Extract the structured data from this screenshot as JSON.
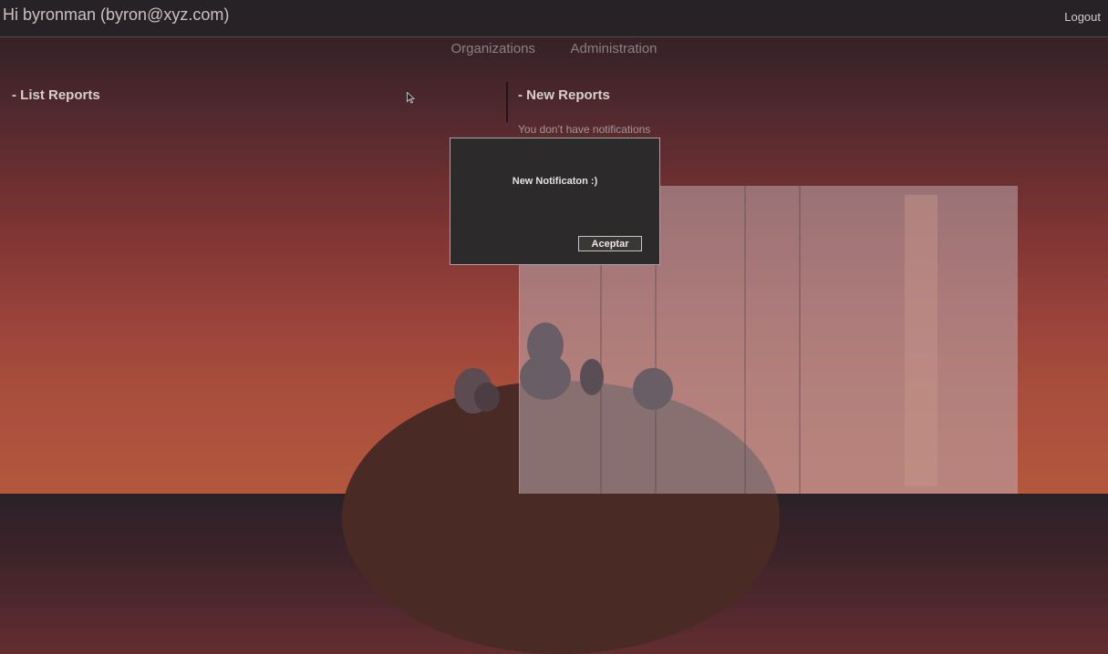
{
  "header": {
    "greeting": "Hi byronman (byron@xyz.com)",
    "logout_label": "Logout"
  },
  "nav": {
    "items": [
      {
        "label": "Organizations"
      },
      {
        "label": "Administration"
      }
    ]
  },
  "main": {
    "list_reports_heading": "- List Reports",
    "new_reports_heading": "- New Reports",
    "no_notifications_text": "You don't have notifications"
  },
  "dialog": {
    "message": "New Notificaton :)",
    "accept_label": "Aceptar"
  },
  "colors": {
    "topbar": "#272225",
    "background_top": "#2a2127",
    "background_bottom": "#b4573e",
    "dialog_bg": "#2c2a2a"
  },
  "icons": {
    "cursor": "mouse-pointer-icon"
  }
}
